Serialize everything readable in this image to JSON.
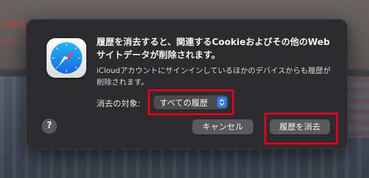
{
  "background": {
    "line1": "多要素",
    "line2": "スキー"
  },
  "dialog": {
    "title": "履歴を消去すると、関連するCookieおよびその他のWebサイトデータが削除されます。",
    "message": "iCloudアカウントにサインインしているほかのデバイスからも履歴が削除されます。",
    "clear_label": "消去の対象:",
    "clear_select": {
      "selected": "すべての履歴"
    },
    "help_label": "?",
    "cancel_label": "キャンセル",
    "clear_button_label": "履歴を消去"
  },
  "colors": {
    "dialog_bg": "#2c2c2e",
    "accent": "#2f7cf6",
    "highlight": "#e4001b"
  },
  "icons": {
    "app": "safari-compass-icon",
    "stepper": "up-down-chevron-icon"
  }
}
